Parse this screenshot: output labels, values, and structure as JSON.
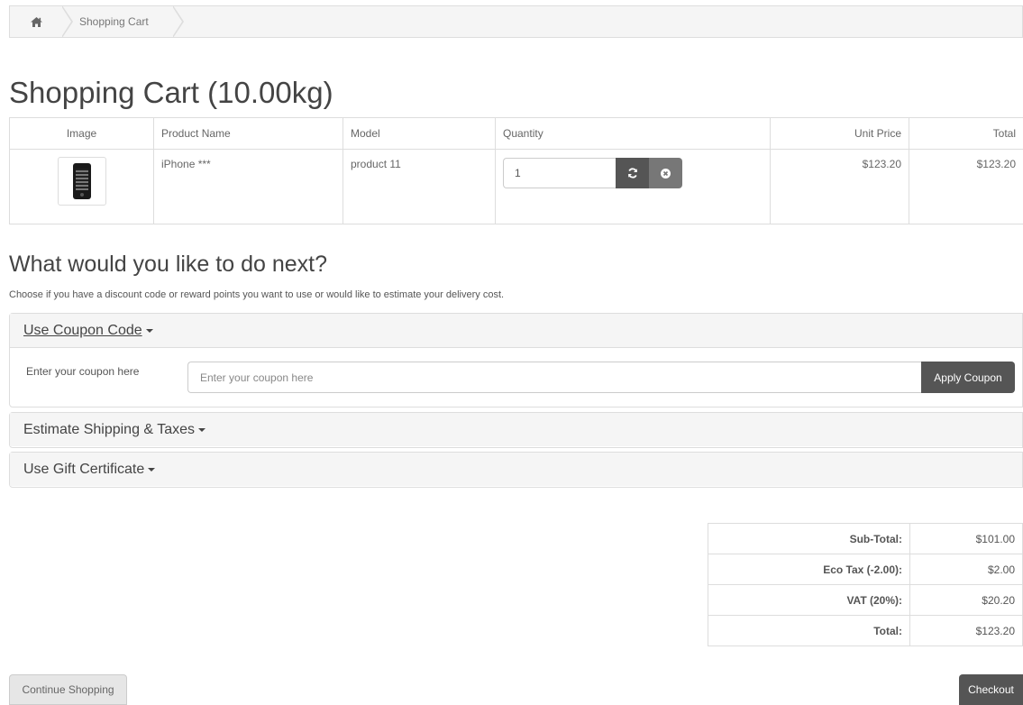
{
  "breadcrumb": {
    "home_icon": "home-icon",
    "current": "Shopping Cart"
  },
  "page": {
    "title": "Shopping Cart  (10.00kg)"
  },
  "cart": {
    "headers": {
      "image": "Image",
      "name": "Product Name",
      "model": "Model",
      "quantity": "Quantity",
      "unit_price": "Unit Price",
      "total": "Total"
    },
    "items": [
      {
        "image_icon": "phone-thumbnail",
        "name": "iPhone ***",
        "model": "product 11",
        "quantity": "1",
        "unit_price": "$123.20",
        "total": "$123.20"
      }
    ]
  },
  "next": {
    "title": "What would you like to do next?",
    "description": "Choose if you have a discount code or reward points you want to use or would like to estimate your delivery cost."
  },
  "coupon": {
    "heading": "Use Coupon Code",
    "label": "Enter your coupon here",
    "placeholder": "Enter your coupon here",
    "button": "Apply Coupon"
  },
  "shipping": {
    "heading": "Estimate Shipping & Taxes"
  },
  "voucher": {
    "heading": "Use Gift Certificate"
  },
  "totals": [
    {
      "label": "Sub-Total:",
      "value": "$101.00"
    },
    {
      "label": "Eco Tax (-2.00):",
      "value": "$2.00"
    },
    {
      "label": "VAT (20%):",
      "value": "$20.20"
    },
    {
      "label": "Total:",
      "value": "$123.20"
    }
  ],
  "buttons": {
    "continue": "Continue Shopping",
    "checkout": "Checkout"
  },
  "colors": {
    "dark_button": "#555555",
    "panel_bg": "#f5f5f5",
    "border": "#dddddd"
  }
}
